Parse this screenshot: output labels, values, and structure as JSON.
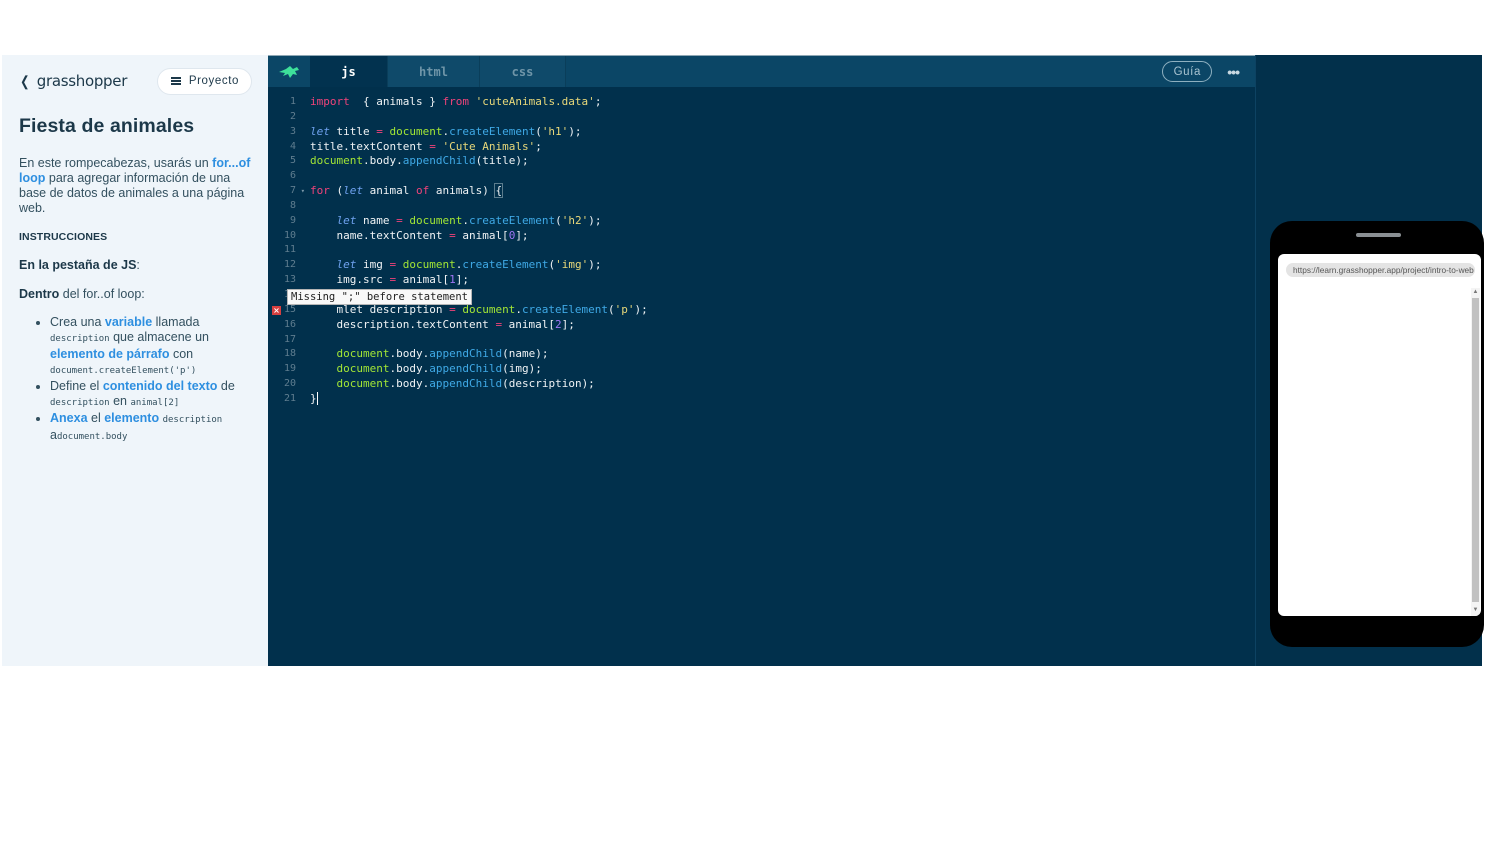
{
  "sidebar": {
    "back_icon": "chevron-left-icon",
    "brand": "grasshopper",
    "project_button": "Proyecto",
    "project_icon": "list-icon",
    "title": "Fiesta de animales",
    "intro": {
      "before": "En este rompecabezas, usarás un ",
      "link": "for...of loop",
      "after": " para agregar información de una base de datos de animales a una página web."
    },
    "instructions_heading": "INSTRUCCIONES",
    "tab_step": {
      "bold": "En la pestaña de JS",
      "rest": ":"
    },
    "loop_step": {
      "bold": "Dentro",
      "rest": " del for..of loop:"
    },
    "tasks": [
      {
        "t1": "Crea una ",
        "l1": "variable",
        "t2": " llamada ",
        "c1": "description",
        "t3": " que almacene un ",
        "l2": "elemento de párrafo",
        "t4": " con ",
        "c2": "document.createElement('p')"
      },
      {
        "t1": "Define el ",
        "l1": "contenido del texto",
        "t2": " de ",
        "c1": "description",
        "t3": " en ",
        "c2": "animal[2]"
      },
      {
        "l1": "Anexa",
        "t1": " el ",
        "l2": "elemento",
        "t2": " ",
        "c1": "description",
        "t3": " a",
        "c2": "document.body"
      }
    ]
  },
  "editor": {
    "logo_icon": "grasshopper-icon",
    "tabs": [
      {
        "label": "js",
        "active": true
      },
      {
        "label": "html",
        "active": false
      },
      {
        "label": "css",
        "active": false
      }
    ],
    "guide_button": "Guía",
    "more_icon": "more-horizontal-icon",
    "error_tooltip": "Missing \";\" before statement",
    "error_line": 15,
    "lines": [
      {
        "n": "1",
        "tokens": [
          [
            "kw",
            "import"
          ],
          [
            "",
            "  { animals } "
          ],
          [
            "kw",
            "from"
          ],
          [
            "",
            ""
          ],
          [
            "str",
            " 'cuteAnimals.data'"
          ],
          [
            "",
            ";"
          ]
        ]
      },
      {
        "n": "2",
        "tokens": []
      },
      {
        "n": "3",
        "tokens": [
          [
            "kwi",
            "let"
          ],
          [
            "",
            " title "
          ],
          [
            "op",
            "="
          ],
          [
            "",
            " "
          ],
          [
            "obj",
            "document"
          ],
          [
            "",
            "."
          ],
          [
            "fn",
            "createElement"
          ],
          [
            "",
            "("
          ],
          [
            "str",
            "'h1'"
          ],
          [
            "",
            ");"
          ]
        ]
      },
      {
        "n": "4",
        "tokens": [
          [
            "",
            "title.textContent "
          ],
          [
            "op",
            "="
          ],
          [
            "",
            " "
          ],
          [
            "str",
            "'Cute Animals'"
          ],
          [
            "",
            ";"
          ]
        ]
      },
      {
        "n": "5",
        "tokens": [
          [
            "obj",
            "document"
          ],
          [
            "",
            ".body."
          ],
          [
            "fn",
            "appendChild"
          ],
          [
            "",
            "(title);"
          ]
        ]
      },
      {
        "n": "6",
        "tokens": []
      },
      {
        "n": "7",
        "fold": true,
        "tokens": [
          [
            "kw",
            "for"
          ],
          [
            "",
            " ("
          ],
          [
            "kwi",
            "let"
          ],
          [
            "",
            " animal "
          ],
          [
            "kw",
            "of"
          ],
          [
            "",
            " animals) "
          ],
          [
            "bracket",
            "{"
          ]
        ]
      },
      {
        "n": "8",
        "tokens": []
      },
      {
        "n": "9",
        "tokens": [
          [
            "",
            "    "
          ],
          [
            "kwi",
            "let"
          ],
          [
            "",
            " name "
          ],
          [
            "op",
            "="
          ],
          [
            "",
            " "
          ],
          [
            "obj",
            "document"
          ],
          [
            "",
            "."
          ],
          [
            "fn",
            "createElement"
          ],
          [
            "",
            "("
          ],
          [
            "str",
            "'h2'"
          ],
          [
            "",
            ");"
          ]
        ]
      },
      {
        "n": "10",
        "tokens": [
          [
            "",
            "    name.textContent "
          ],
          [
            "op",
            "="
          ],
          [
            "",
            " animal["
          ],
          [
            "num",
            "0"
          ],
          [
            "",
            "];"
          ]
        ]
      },
      {
        "n": "11",
        "tokens": []
      },
      {
        "n": "12",
        "tokens": [
          [
            "",
            "    "
          ],
          [
            "kwi",
            "let"
          ],
          [
            "",
            " img "
          ],
          [
            "op",
            "="
          ],
          [
            "",
            " "
          ],
          [
            "obj",
            "document"
          ],
          [
            "",
            "."
          ],
          [
            "fn",
            "createElement"
          ],
          [
            "",
            "("
          ],
          [
            "str",
            "'img'"
          ],
          [
            "",
            ");"
          ]
        ]
      },
      {
        "n": "13",
        "tokens": [
          [
            "",
            "    img.src "
          ],
          [
            "op",
            "="
          ],
          [
            "",
            " animal["
          ],
          [
            "num",
            "1"
          ],
          [
            "",
            "];"
          ]
        ]
      },
      {
        "n": "14",
        "tokens": []
      },
      {
        "n": "15",
        "error": true,
        "tokens": [
          [
            "",
            "    mlet description "
          ],
          [
            "op",
            "="
          ],
          [
            "",
            " "
          ],
          [
            "obj",
            "document"
          ],
          [
            "",
            "."
          ],
          [
            "fn",
            "createElement"
          ],
          [
            "",
            "("
          ],
          [
            "str",
            "'p'"
          ],
          [
            "",
            ");"
          ]
        ]
      },
      {
        "n": "16",
        "tokens": [
          [
            "",
            "    description.textContent "
          ],
          [
            "op",
            "="
          ],
          [
            "",
            " animal["
          ],
          [
            "num",
            "2"
          ],
          [
            "",
            "];"
          ]
        ]
      },
      {
        "n": "17",
        "tokens": []
      },
      {
        "n": "18",
        "tokens": [
          [
            "",
            "    "
          ],
          [
            "obj",
            "document"
          ],
          [
            "",
            ".body."
          ],
          [
            "fn",
            "appendChild"
          ],
          [
            "",
            "(name);"
          ]
        ]
      },
      {
        "n": "19",
        "tokens": [
          [
            "",
            "    "
          ],
          [
            "obj",
            "document"
          ],
          [
            "",
            ".body."
          ],
          [
            "fn",
            "appendChild"
          ],
          [
            "",
            "(img);"
          ]
        ]
      },
      {
        "n": "20",
        "tokens": [
          [
            "",
            "    "
          ],
          [
            "obj",
            "document"
          ],
          [
            "",
            ".body."
          ],
          [
            "fn",
            "appendChild"
          ],
          [
            "",
            "(description);"
          ]
        ]
      },
      {
        "n": "21",
        "cursor": true,
        "tokens": [
          [
            "",
            "}"
          ]
        ]
      }
    ]
  },
  "preview": {
    "url": "https://learn.grasshopper.app/project/intro-to-web"
  },
  "colors": {
    "sidebar_bg": "#eff5fa",
    "editor_bg": "#01304c",
    "tab_bar": "#0b4666",
    "link": "#2e8fe0",
    "brand_green": "#3ee09a"
  }
}
